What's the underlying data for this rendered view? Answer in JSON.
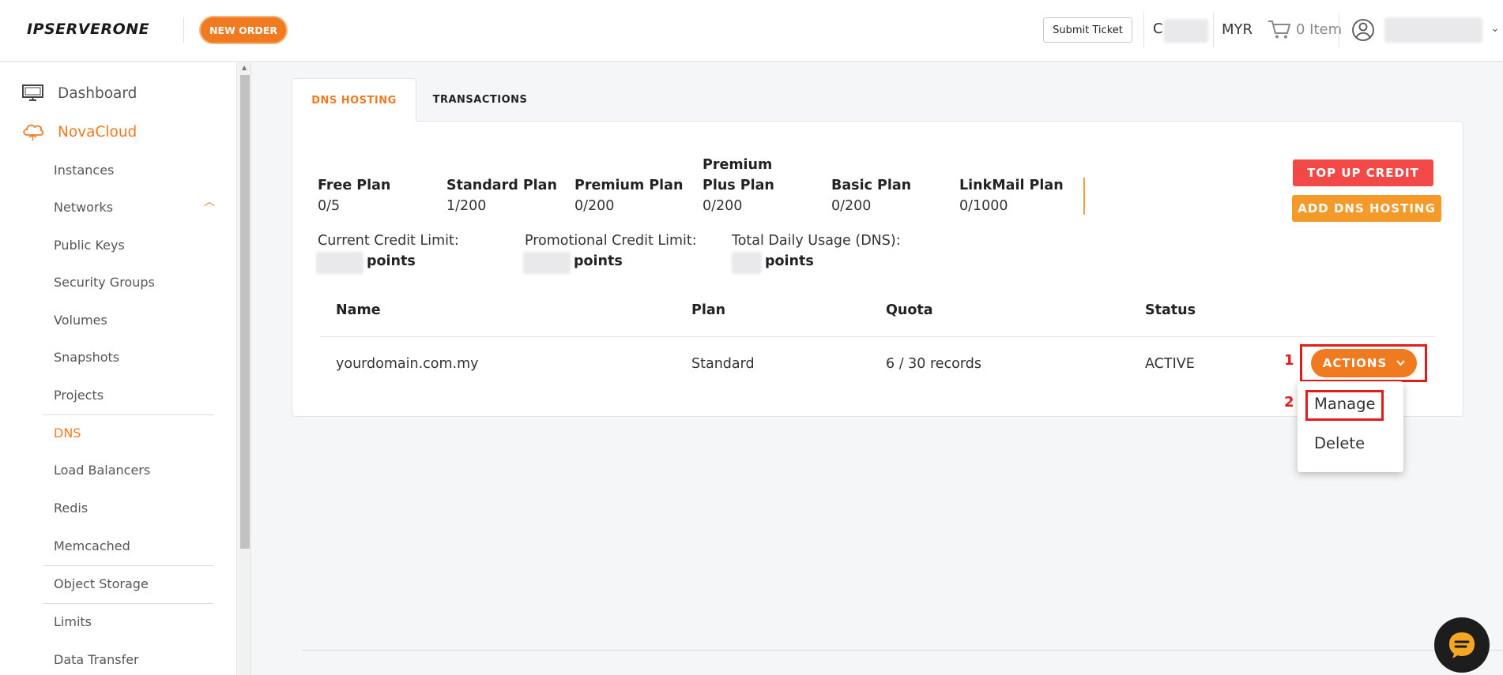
{
  "header": {
    "logo_text": "IPSERVERONE",
    "new_order_label": "NEW ORDER",
    "submit_ticket_label": "Submit Ticket",
    "credit_prefix": "C",
    "currency": "MYR",
    "cart_label": "0 Item"
  },
  "sidebar": {
    "dashboard_label": "Dashboard",
    "novacloud_label": "NovaCloud",
    "items": [
      {
        "label": "Instances"
      },
      {
        "label": "Networks"
      },
      {
        "label": "Public Keys"
      },
      {
        "label": "Security Groups"
      },
      {
        "label": "Volumes"
      },
      {
        "label": "Snapshots"
      },
      {
        "label": "Projects"
      },
      {
        "label": "DNS",
        "active": true
      },
      {
        "label": "Load Balancers"
      },
      {
        "label": "Redis"
      },
      {
        "label": "Memcached"
      },
      {
        "label": "Object Storage"
      },
      {
        "label": "Limits"
      },
      {
        "label": "Data Transfer"
      }
    ]
  },
  "tabs": {
    "dns_hosting": "DNS HOSTING",
    "transactions": "TRANSACTIONS"
  },
  "plans": [
    {
      "name": "Free Plan",
      "usage": "0/5"
    },
    {
      "name": "Standard Plan",
      "usage": "1/200"
    },
    {
      "name": "Premium Plan",
      "usage": "0/200"
    },
    {
      "name": "Premium Plus Plan",
      "usage": "0/200"
    },
    {
      "name": "Basic Plan",
      "usage": "0/200"
    },
    {
      "name": "LinkMail Plan",
      "usage": "0/1000"
    }
  ],
  "buttons": {
    "top_up_credit": "TOP UP CREDIT",
    "add_dns_hosting": "ADD DNS HOSTING"
  },
  "credits": {
    "current_label": "Current Credit Limit:",
    "promotional_label": "Promotional Credit Limit:",
    "daily_usage_label": "Total Daily Usage (DNS):",
    "unit": "points"
  },
  "table": {
    "headers": [
      "Name",
      "Plan",
      "Quota",
      "Status"
    ],
    "rows": [
      {
        "name": "yourdomain.com.my",
        "plan": "Standard",
        "quota": "6 / 30 records",
        "status": "ACTIVE"
      }
    ]
  },
  "actions": {
    "button_label": "ACTIONS",
    "menu": [
      "Manage",
      "Delete"
    ]
  },
  "annotations": {
    "step1": "1",
    "step2": "2"
  },
  "colors": {
    "accent": "#f07a1f",
    "danger": "#f24848",
    "warning": "#f49a2a",
    "annotation": "#e41b1b"
  }
}
